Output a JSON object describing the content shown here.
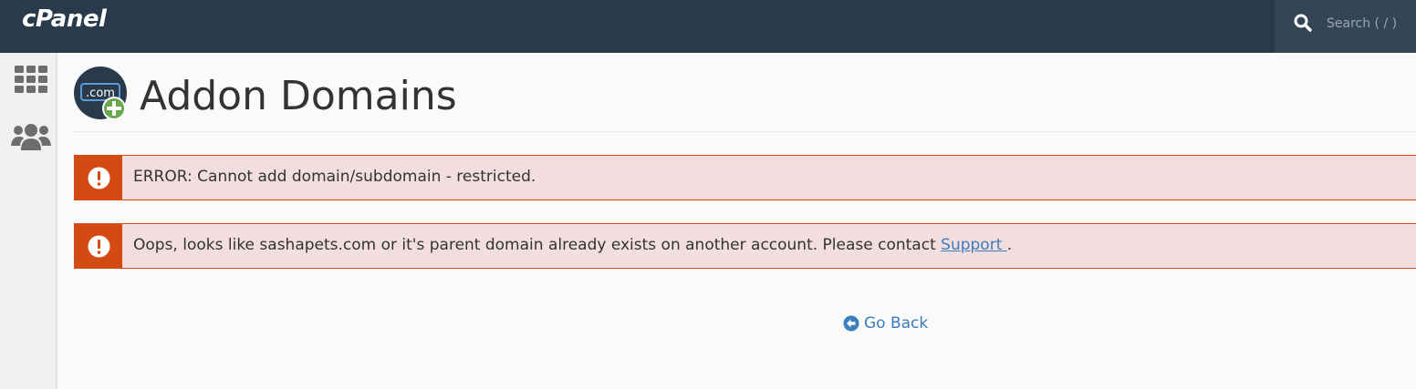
{
  "app": {
    "logo_text": "cPanel",
    "search_placeholder": "Search ( / )"
  },
  "page": {
    "title": "Addon Domains",
    "icon_text": ".com"
  },
  "alerts": [
    {
      "type": "error",
      "text": "ERROR: Cannot add domain/subdomain - restricted."
    },
    {
      "type": "error",
      "text_before": "Oops, looks like sashapets.com or it's parent domain already exists on another account. Please contact ",
      "link_label": "Support ",
      "text_after": "."
    }
  ],
  "actions": {
    "go_back_label": "Go Back"
  },
  "sidebar": {
    "items": [
      {
        "icon": "grid-apps-icon"
      },
      {
        "icon": "users-icon"
      }
    ]
  },
  "colors": {
    "topbar": "#293a4a",
    "alert_accent": "#d34a12",
    "alert_bg": "#f2dede",
    "link": "#3c7dbd"
  }
}
